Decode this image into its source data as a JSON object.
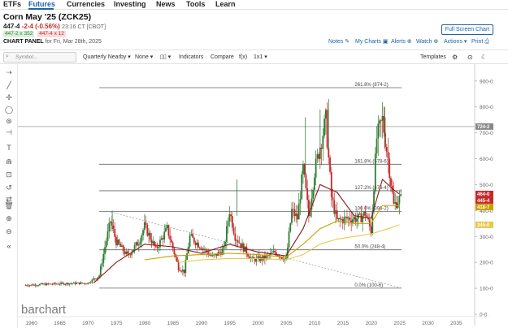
{
  "nav": {
    "tabs": [
      "ETFs",
      "Futures",
      "Currencies",
      "Investing",
      "News",
      "Tools",
      "Learn"
    ],
    "active": "Futures"
  },
  "quote": {
    "title": "Corn May '25 (ZCK25)",
    "last": "447-4",
    "change": "-2-4 (-0.56%)",
    "time": "23:16 CT [CBOT]",
    "bid": "447-2 x 352",
    "ask": "447-4 x 12",
    "panel_label": "CHART PANEL",
    "panel_date": "for Fri, Mar 28th, 2025"
  },
  "header_buttons": {
    "fullscreen": "Full Screen Chart",
    "notes": "Notes",
    "my_charts": "My Charts",
    "alerts": "Alerts",
    "watch": "Watch",
    "actions": "Actions",
    "print": "Print"
  },
  "toolbar": {
    "search_placeholder": "Symbol...",
    "period": "Quarterly Nearby",
    "compare_none": "None",
    "indicators": "Indicators",
    "compare": "Compare",
    "fx": "f(x)",
    "ratio": "1x1",
    "templates": "Templates"
  },
  "watermark": "barchart",
  "colors": {
    "accent": "#1d62a8",
    "up": "#2e7d32",
    "down": "#c62828",
    "ma_short": "#8b1a1a",
    "ma_mid": "#c8a000",
    "ma_long": "#e8c84a"
  },
  "chart_data": {
    "type": "candlestick",
    "x_ticks": [
      "1960",
      "1965",
      "1970",
      "1975",
      "1980",
      "1985",
      "1990",
      "1995",
      "2000",
      "2005",
      "2010",
      "2015",
      "2020",
      "2025",
      "2030",
      "2035"
    ],
    "y_ticks": [
      "900-0",
      "800-0",
      "700-0",
      "600-0",
      "500-0",
      "400-0",
      "300-0",
      "200-0",
      "100-0",
      "0-0"
    ],
    "ylim": [
      0,
      940
    ],
    "fib_levels": [
      {
        "label": "261.8% (874-2)",
        "value": 874.25
      },
      {
        "label": "161.8% (578-6)",
        "value": 578.75
      },
      {
        "label": "127.2% (476-4)",
        "value": 476.5
      },
      {
        "label": "100.0% (396-2)",
        "value": 396.25
      },
      {
        "label": "50.0% (248-4)",
        "value": 248.5
      },
      {
        "label": "0.0% (100-6)",
        "value": 100.75
      }
    ],
    "price_labels": [
      {
        "text": "724-2",
        "value": 724.25,
        "color": "#888888"
      },
      {
        "text": "464-0",
        "value": 464,
        "color": "#c62828"
      },
      {
        "text": "445-4",
        "value": 445.5,
        "color": "#c62828"
      },
      {
        "text": "418-7",
        "value": 418.75,
        "color": "#c8a000"
      },
      {
        "text": "345-0",
        "value": 345,
        "color": "#e8c84a"
      }
    ],
    "series": [
      {
        "name": "Price",
        "x": [
          1959,
          1965,
          1970,
          1972,
          1973,
          1974,
          1975,
          1977,
          1979,
          1980,
          1982,
          1984,
          1986,
          1987,
          1988,
          1990,
          1992,
          1994,
          1995,
          1996,
          1997,
          1999,
          2001,
          2003,
          2005,
          2006,
          2007,
          2008,
          2009,
          2010,
          2011,
          2012,
          2013,
          2014,
          2016,
          2018,
          2019,
          2020,
          2021,
          2022,
          2023,
          2024,
          2025
        ],
        "y": [
          112,
          118,
          120,
          150,
          260,
          360,
          280,
          225,
          280,
          340,
          250,
          330,
          180,
          165,
          300,
          260,
          220,
          250,
          400,
          300,
          270,
          210,
          215,
          240,
          210,
          400,
          370,
          560,
          380,
          550,
          650,
          750,
          450,
          360,
          370,
          370,
          390,
          320,
          680,
          750,
          600,
          420,
          445
        ]
      },
      {
        "name": "MA short",
        "x": [
          1971,
          1975,
          1980,
          1985,
          1990,
          1995,
          2000,
          2005,
          2008,
          2011,
          2014,
          2017,
          2020,
          2022,
          2024,
          2025
        ],
        "y": [
          120,
          200,
          270,
          260,
          235,
          270,
          240,
          225,
          330,
          500,
          470,
          380,
          370,
          520,
          480,
          464
        ]
      },
      {
        "name": "MA mid",
        "x": [
          1980,
          1985,
          1990,
          1995,
          2000,
          2005,
          2008,
          2011,
          2014,
          2017,
          2020,
          2022,
          2025
        ],
        "y": [
          210,
          225,
          230,
          235,
          230,
          220,
          270,
          330,
          360,
          350,
          350,
          420,
          418
        ]
      },
      {
        "name": "MA long",
        "x": [
          1986,
          1990,
          1995,
          2000,
          2005,
          2008,
          2011,
          2014,
          2017,
          2020,
          2023,
          2025
        ],
        "y": [
          200,
          210,
          215,
          215,
          210,
          230,
          270,
          290,
          300,
          310,
          330,
          345
        ]
      }
    ]
  }
}
